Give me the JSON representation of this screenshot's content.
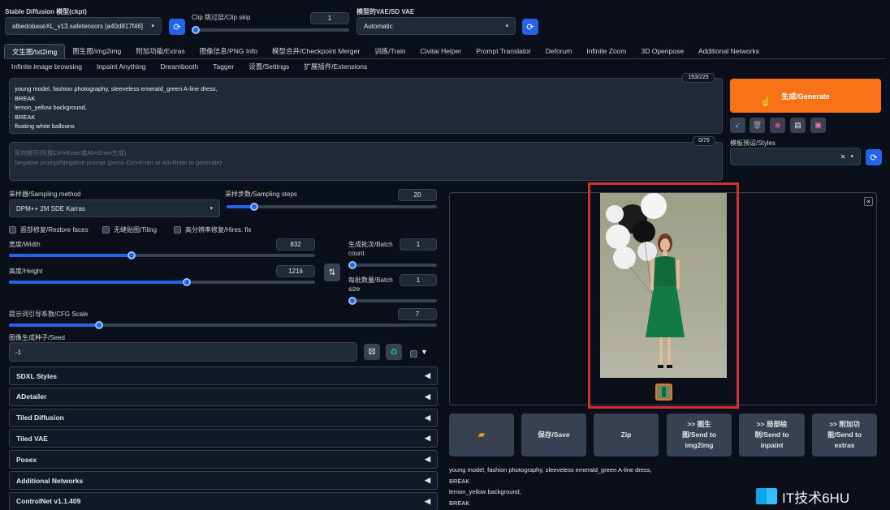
{
  "header": {
    "ckpt_label": "Stable Diffusion 模型(ckpt)",
    "ckpt_value": "albedobaseXL_v13.safetensors [a40d817f46]",
    "clip_label": "Clip 跳过层/Clip skip",
    "clip_value": "1",
    "vae_label": "模型的VAE/SD VAE",
    "vae_value": "Automatic"
  },
  "tabs_row1": [
    "文生图/txt2img",
    "图生图/img2img",
    "附加功能/Extras",
    "图像信息/PNG Info",
    "模型合并/Checkpoint Merger",
    "训练/Train",
    "Civitai Helper",
    "Prompt Translator",
    "Deforum",
    "Infinite Zoom",
    "3D Openpose",
    "Additional Networks"
  ],
  "tabs_row2": [
    "Infinite image browsing",
    "Inpaint Anything",
    "Dreambooth",
    "Tagger",
    "设置/Settings",
    "扩展插件/Extensions"
  ],
  "prompt": {
    "lines": [
      "young model, fashion photography, sleeveless emerald_green A-line dress,",
      "BREAK",
      "lemon_yellow background,",
      "BREAK",
      "floating white balloons"
    ],
    "token_count": "153/225"
  },
  "negative": {
    "placeholder_line1": "反向提示词(按Ctrl+Enter或Alt+Enter生成)",
    "placeholder_line2": "Negative prompt/Negative prompt (press Ctrl+Enter or Alt+Enter to generate)",
    "token_count": "0/75"
  },
  "generate_label": "生成/Generate",
  "styles_label": "模板预设/Styles",
  "sampling": {
    "method_label": "采样器/Sampling method",
    "method_value": "DPM++ 2M SDE Karras",
    "steps_label": "采样步数/Sampling steps",
    "steps_value": "20",
    "steps_fraction": 0.13
  },
  "options": {
    "restore_faces": "面部修复/Restore faces",
    "tiling": "无缝贴图/Tiling",
    "hires": "高分辨率修复/Hires. fix"
  },
  "size": {
    "width_label": "宽度/Width",
    "width_value": "832",
    "width_fraction": 0.4,
    "height_label": "高度/Height",
    "height_value": "1216",
    "height_fraction": 0.58
  },
  "batch": {
    "count_label_1": "生成批次/Batch",
    "count_label_2": "count",
    "count_value": "1",
    "size_label_1": "每批数量/Batch",
    "size_label_2": "size",
    "size_value": "1"
  },
  "cfg": {
    "label": "提示词引导系数/CFG Scale",
    "value": "7",
    "fraction": 0.21
  },
  "seed": {
    "label": "图像生成种子/Seed",
    "value": "-1"
  },
  "accordions": [
    "SDXL Styles",
    "ADetailer",
    "Tiled Diffusion",
    "Tiled VAE",
    "Posex",
    "Additional Networks",
    "ControlNet v1.1.409"
  ],
  "actions": {
    "folder_icon": "folder-icon",
    "save": "保存/Save",
    "zip": "Zip",
    "img2img_1": ">> 图生",
    "img2img_2": "图/Send to",
    "img2img_3": "img2img",
    "inpaint_1": ">> 局部绘",
    "inpaint_2": "制/Send to",
    "inpaint_3": "inpaint",
    "extras_1": ">> 附加功",
    "extras_2": "能/Send to",
    "extras_3": "extras"
  },
  "output_info": [
    "young model, fashion photography, sleeveless emerald_green A-line dress,",
    "BREAK",
    "lemon_yellow background,",
    "BREAK"
  ],
  "watermark": "IT技术6HU",
  "colors": {
    "accent": "#2563eb",
    "generate": "#f97316",
    "highlight": "#d32f2f"
  }
}
